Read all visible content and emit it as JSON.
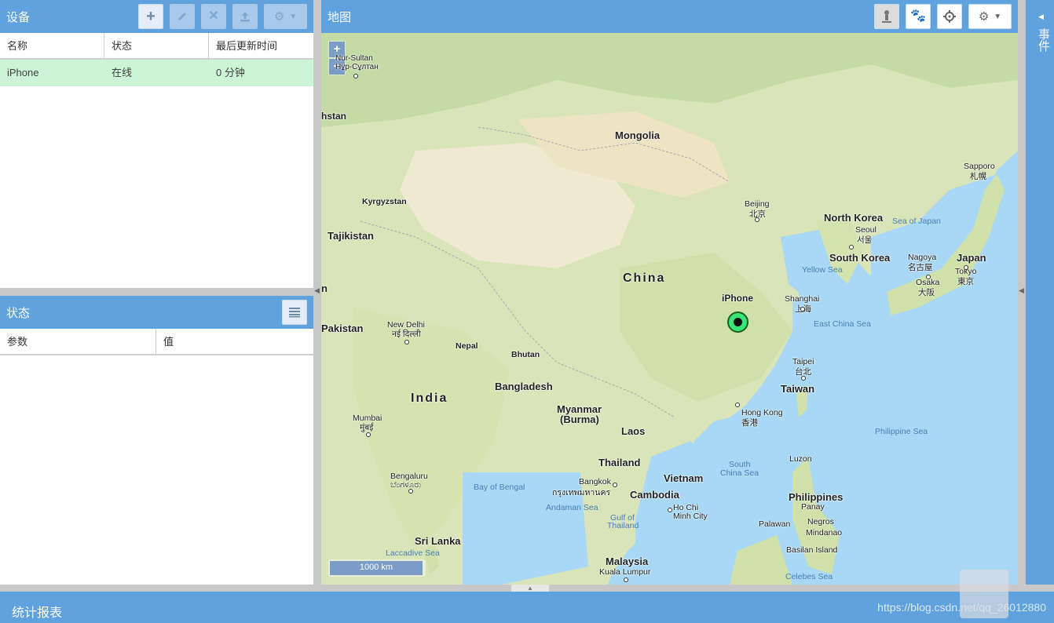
{
  "devices": {
    "title": "设备",
    "columns": [
      "名称",
      "状态",
      "最后更新时间"
    ],
    "rows": [
      {
        "name": "iPhone",
        "status": "在线",
        "updated": "0 分钟"
      }
    ]
  },
  "status_panel": {
    "title": "状态",
    "columns": [
      "参数",
      "值"
    ]
  },
  "map_panel": {
    "title": "地图",
    "zoom_in": "+",
    "zoom_out": "−",
    "scale": "1000 km",
    "marker_label": "iPhone",
    "labels": {
      "nursultan": "Nur-Sultan",
      "nursultan2": "Нұр-Сұлтан",
      "hstan": "hstan",
      "mongolia": "Mongolia",
      "kyrgyzstan": "Kyrgyzstan",
      "tajikistan": "Tajikistan",
      "beijing": "Beijing",
      "beijing2": "北京",
      "northkorea": "North Korea",
      "seoul": "Seoul",
      "seoul2": "서울",
      "southkorea": "South Korea",
      "seaofjapan": "Sea of Japan",
      "sapporo": "Sapporo",
      "sapporo2": "札幌",
      "nagoya": "Nagoya",
      "nagoya2": "名古屋",
      "japan": "Japan",
      "tokyo": "Tokyo",
      "tokyo2": "東京",
      "osaka": "Osaka",
      "osaka2": "大阪",
      "yellowsea": "Yellow Sea",
      "china": "China",
      "n": "n",
      "shanghai": "Shanghai",
      "shanghai2": "上海",
      "eastchinasea": "East China Sea",
      "pakistan": "Pakistan",
      "newdelhi": "New Delhi",
      "newdelhi2": "नई दिल्ली",
      "nepal": "Nepal",
      "bhutan": "Bhutan",
      "taipei": "Taipei",
      "taipei2": "台北",
      "taiwan": "Taiwan",
      "bangladesh": "Bangladesh",
      "india": "India",
      "myanmar": "Myanmar",
      "burma": "(Burma)",
      "hongkong": "Hong Kong",
      "hongkong2": "香港",
      "laos": "Laos",
      "mumbai": "Mumbai",
      "mumbai2": "मुंबई",
      "philippinesea": "Philippine Sea",
      "thailand": "Thailand",
      "luzon": "Luzon",
      "southchinasea": "South",
      "southchinasea2": "China Sea",
      "bengaluru": "Bengaluru",
      "bengaluru2": "ಬೆಂಗಳೂರು",
      "bangkok": "Bangkok",
      "bangkok2": "กรุงเทพมหานคร",
      "vietnam": "Vietnam",
      "bayofbengal": "Bay of Bengal",
      "cambodia": "Cambodia",
      "philippines": "Philippines",
      "panay": "Panay",
      "andamansea": "Andaman Sea",
      "hochiminh": "Ho Chi",
      "hochiminh2": "Minh City",
      "gulfofthailand": "Gulf of",
      "gulfofthailand2": "Thailand",
      "palawan": "Palawan",
      "negros": "Negros",
      "mindanao": "Mindanao",
      "srilanka": "Sri Lanka",
      "laccadivesea": "Laccadive Sea",
      "basilan": "Basilan Island",
      "malaysia": "Malaysia",
      "kualalumpur": "Kuala Lumpur",
      "celebessea": "Celebes Sea"
    }
  },
  "events_panel": {
    "title": "事件"
  },
  "footer": {
    "title": "统计报表",
    "watermark": "https://blog.csdn.net/qq_26012880"
  },
  "colors": {
    "header": "#5fa2dd",
    "online_row": "#ccf5d8",
    "marker": "#3ae67a"
  }
}
